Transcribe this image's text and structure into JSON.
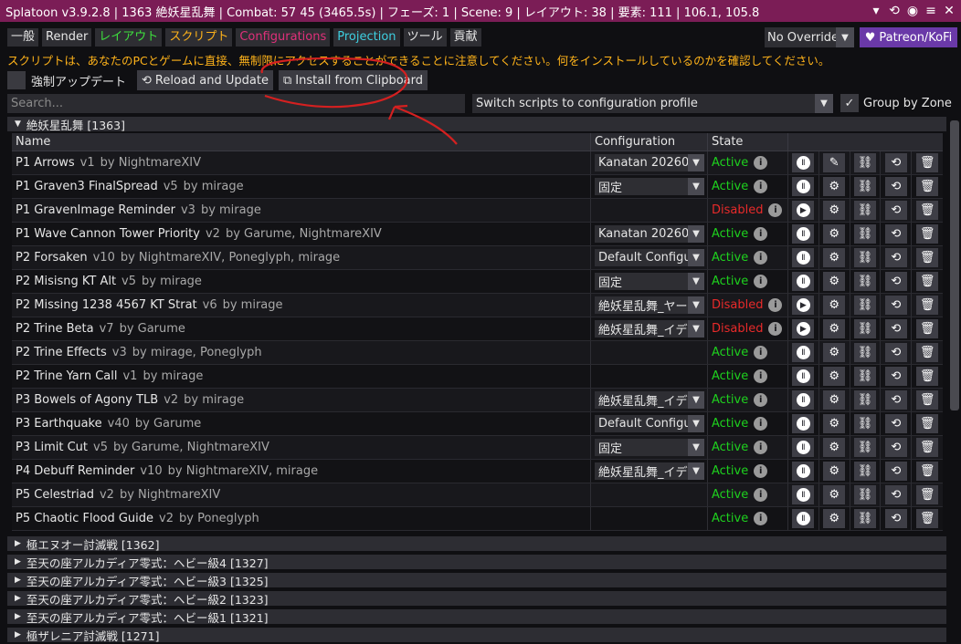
{
  "titlebar": {
    "title": "Splatoon v3.9.2.8 | 1363 絶妖星乱舞 | Combat: 57 45 (3465.5s) | フェーズ: 1 | Scene: 9 | レイアウト: 38 | 要素: 111 | 106.1, 105.8"
  },
  "tabs": [
    "一般",
    "Render",
    "レイアウト",
    "スクリプト",
    "Configurations",
    "Projection",
    "ツール",
    "貢献"
  ],
  "tab_colors": [
    "#e6e6e6",
    "#e6e6e6",
    "#3ee03e",
    "#ffb31a",
    "#e0307a",
    "#3ecfe0",
    "#e6e6e6",
    "#e6e6e6"
  ],
  "override": {
    "label": "No Override"
  },
  "patreon": {
    "label": "Patreon/KoFi"
  },
  "warning": "スクリプトは、あなたのPCとゲームに直接、無制限にアクセスすることができることに注意してください。何をインストールしているのかを確認してください。",
  "toolbar": {
    "force_update_label": "強制アップデート",
    "reload_label": "Reload and Update",
    "install_label": "Install from Clipboard"
  },
  "search": {
    "placeholder": "Search..."
  },
  "profile": {
    "label": "Switch scripts to configuration profile"
  },
  "group_by_zone": {
    "label": "Group by Zone"
  },
  "expanded_group": {
    "label": "絶妖星乱舞 [1363]"
  },
  "table": {
    "headers": {
      "name": "Name",
      "configuration": "Configuration",
      "state": "State"
    },
    "rows": [
      {
        "name": "P1 Arrows",
        "ver": "v1",
        "author": "by NightmareXIV",
        "conf": "Kanatan 20260",
        "state": "Active",
        "toggle": "pause",
        "settings": "brush"
      },
      {
        "name": "P1 Graven3 FinalSpread",
        "ver": "v5",
        "author": "by mirage",
        "conf": "固定",
        "state": "Active",
        "toggle": "pause",
        "settings": "gear"
      },
      {
        "name": "P1 GravenImage Reminder",
        "ver": "v3",
        "author": "by mirage",
        "conf": "",
        "state": "Disabled",
        "toggle": "play",
        "settings": "gear"
      },
      {
        "name": "P1 Wave Cannon Tower Priority",
        "ver": "v2",
        "author": "by Garume, NightmareXIV",
        "conf": "Kanatan 20260",
        "state": "Active",
        "toggle": "pause",
        "settings": "gear"
      },
      {
        "name": "P2 Forsaken",
        "ver": "v10",
        "author": "by NightmareXIV, Poneglyph, mirage",
        "conf": "Default Configu",
        "state": "Active",
        "toggle": "pause",
        "settings": "gear"
      },
      {
        "name": "P2 Misisng KT Alt",
        "ver": "v5",
        "author": "by mirage",
        "conf": "固定",
        "state": "Active",
        "toggle": "pause",
        "settings": "gear"
      },
      {
        "name": "P2 Missing 1238 4567 KT Strat",
        "ver": "v6",
        "author": "by mirage",
        "conf": "絶妖星乱舞_ヤーン",
        "state": "Disabled",
        "toggle": "play",
        "settings": "gear"
      },
      {
        "name": "P2 Trine Beta",
        "ver": "v7",
        "author": "by Garume",
        "conf": "絶妖星乱舞_イディ",
        "state": "Disabled",
        "toggle": "play",
        "settings": "gear"
      },
      {
        "name": "P2 Trine Effects",
        "ver": "v3",
        "author": "by mirage, Poneglyph",
        "conf": "",
        "state": "Active",
        "toggle": "pause",
        "settings": "gear"
      },
      {
        "name": "P2 Trine Yarn Call",
        "ver": "v1",
        "author": "by mirage",
        "conf": "",
        "state": "Active",
        "toggle": "pause",
        "settings": "gear"
      },
      {
        "name": "P3 Bowels of Agony TLB",
        "ver": "v2",
        "author": "by mirage",
        "conf": "絶妖星乱舞_イディ",
        "state": "Active",
        "toggle": "pause",
        "settings": "gear"
      },
      {
        "name": "P3 Earthquake",
        "ver": "v40",
        "author": "by Garume",
        "conf": "Default Configu",
        "state": "Active",
        "toggle": "pause",
        "settings": "gear"
      },
      {
        "name": "P3 Limit Cut",
        "ver": "v5",
        "author": "by Garume, NightmareXIV",
        "conf": "固定",
        "state": "Active",
        "toggle": "pause",
        "settings": "gear"
      },
      {
        "name": "P4 Debuff Reminder",
        "ver": "v10",
        "author": "by NightmareXIV, mirage",
        "conf": "絶妖星乱舞_イディ",
        "state": "Active",
        "toggle": "pause",
        "settings": "gear"
      },
      {
        "name": "P5 Celestriad",
        "ver": "v2",
        "author": "by NightmareXIV",
        "conf": "",
        "state": "Active",
        "toggle": "pause",
        "settings": "gear"
      },
      {
        "name": "P5 Chaotic Flood Guide",
        "ver": "v2",
        "author": "by Poneglyph",
        "conf": "",
        "state": "Active",
        "toggle": "pause",
        "settings": "gear"
      }
    ]
  },
  "collapsed_groups": [
    "極エヌオー討滅戦 [1362]",
    "至天の座アルカディア零式：ヘビー級4 [1327]",
    "至天の座アルカディア零式：ヘビー級3 [1325]",
    "至天の座アルカディア零式：ヘビー級2 [1323]",
    "至天の座アルカディア零式：ヘビー級1 [1321]",
    "極ザレニア討滅戦 [1271]"
  ],
  "colors": {
    "titlebar": "#7b1d56",
    "active": "#1ed11e",
    "disabled": "#e82a2a",
    "warning": "#ffb31a",
    "patreon": "#6a39a8",
    "annotation": "#d42020"
  }
}
